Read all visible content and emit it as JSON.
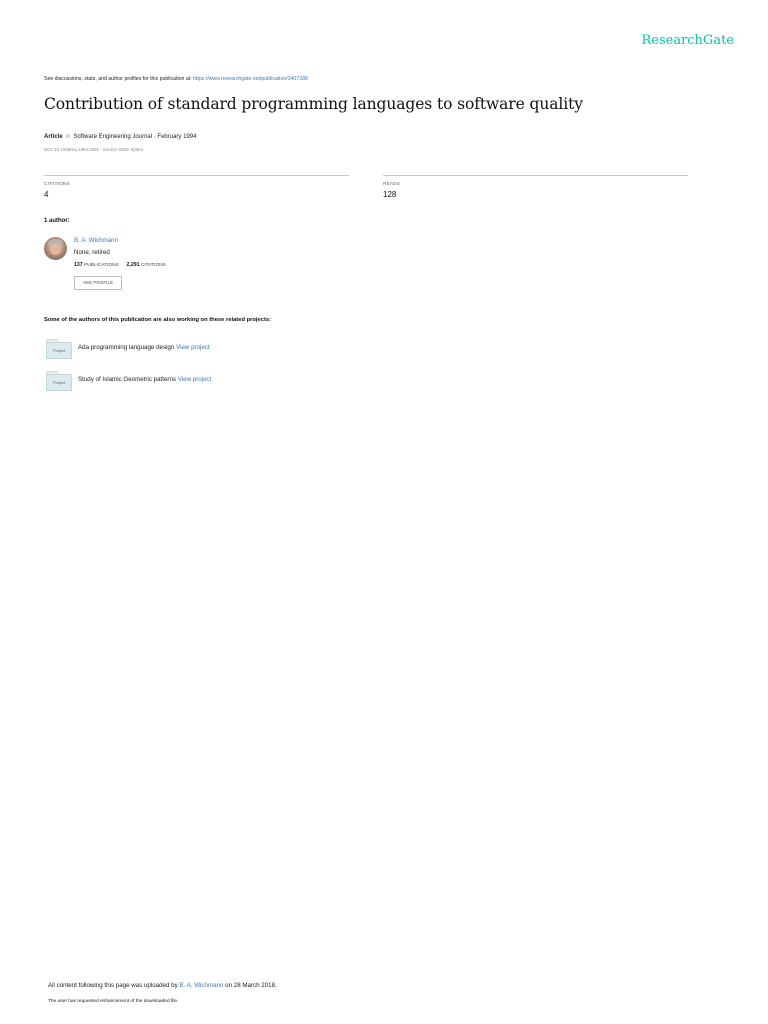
{
  "brand": "ResearchGate",
  "discussion": {
    "text": "See discussions, stats, and author profiles for this publication at: ",
    "url": "https://www.researchgate.net/publication/3407288"
  },
  "title": "Contribution of standard programming languages to software quality",
  "meta": {
    "type": "Article",
    "in": "in",
    "journal": "Software Engineering Journal · February 1994",
    "doi": "DOI: 10.1049/sej.1994.0002 · Source: IEEE Xplore"
  },
  "stats": {
    "citations_label": "CITATIONS",
    "citations_value": "4",
    "reads_label": "READS",
    "reads_value": "128"
  },
  "authors": {
    "heading": "1 author:",
    "list": [
      {
        "name": "B. A. Wichmann",
        "affiliation": "None, retired",
        "publications_count": "137",
        "publications_label": "PUBLICATIONS",
        "citations_count": "2,291",
        "citations_label": "CITATIONS",
        "profile_button": "SEE PROFILE"
      }
    ]
  },
  "related": {
    "heading": "Some of the authors of this publication are also working on these related projects:",
    "projects": [
      {
        "badge": "Project",
        "title": "Ada programming language design",
        "link": "View project"
      },
      {
        "badge": "Project",
        "title": "Study of Islamic Geometric patterns",
        "link": "View project"
      }
    ]
  },
  "footer": {
    "uploaded_prefix": "All content following this page was uploaded by ",
    "uploaded_by": "B. A. Wichmann",
    "uploaded_suffix": " on 28 March 2018.",
    "enhancement": "The user has requested enhancement of the downloaded file."
  },
  "colors": {
    "brand": "#00c7a9",
    "link": "#3b79b8",
    "project_badge": "#dcebee"
  }
}
